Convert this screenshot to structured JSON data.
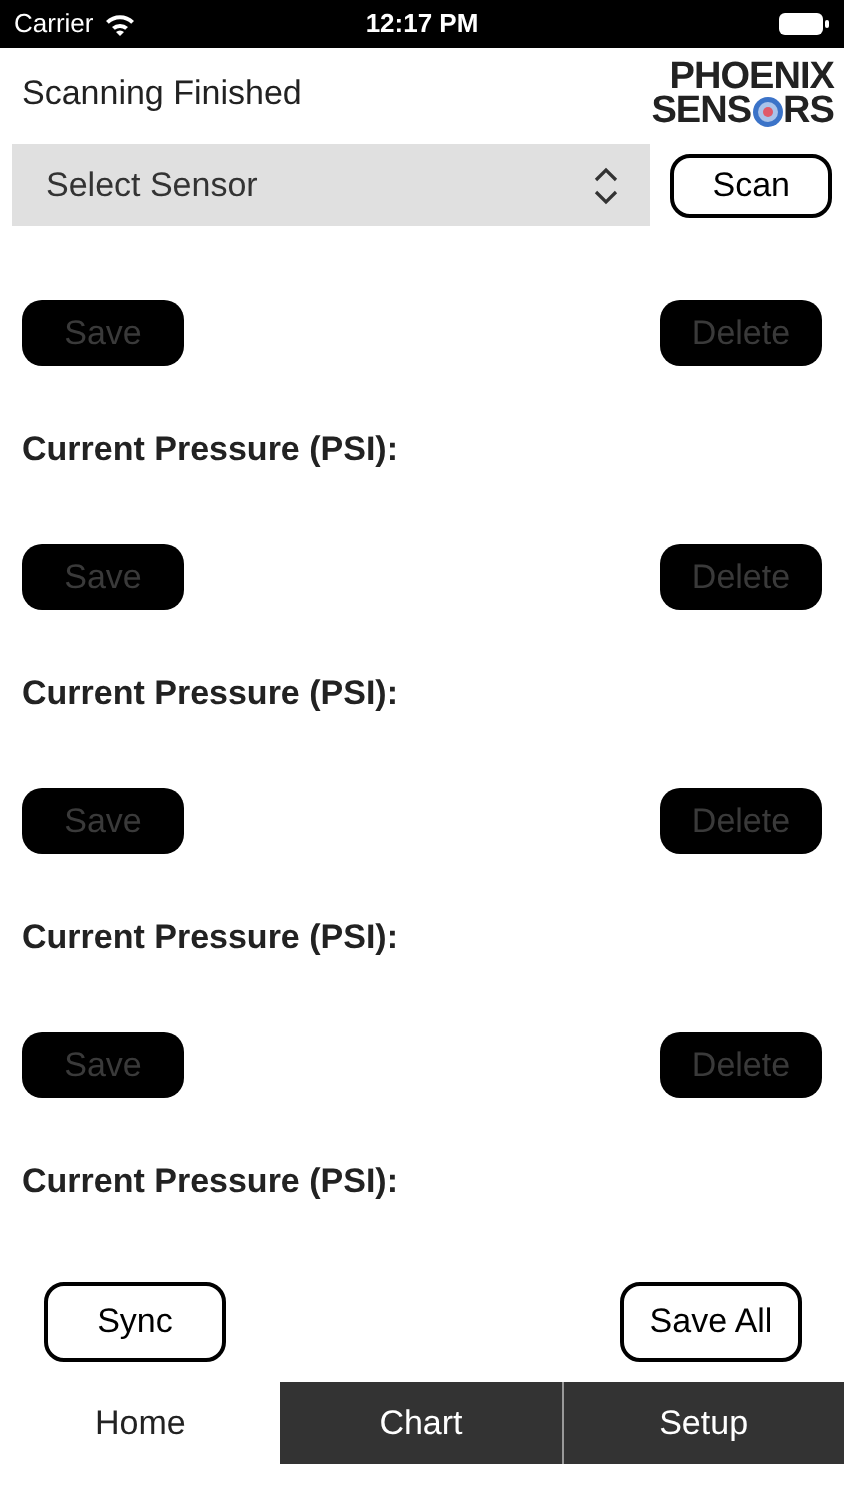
{
  "status_bar": {
    "carrier": "Carrier",
    "time": "12:17 PM"
  },
  "header": {
    "status": "Scanning Finished",
    "logo": {
      "line1": "PHOENIX",
      "line2_start": "SENS",
      "line2_end": "RS"
    }
  },
  "sensor_select": {
    "value": "Select Sensor"
  },
  "scan_button": "Scan",
  "sensors": [
    {
      "save": {
        "label": "Save",
        "disabled": true
      },
      "delete": {
        "label": "Delete",
        "disabled": true
      },
      "pressure_label": "Current Pressure (PSI):"
    },
    {
      "save": {
        "label": "Save",
        "disabled": true
      },
      "delete": {
        "label": "Delete",
        "disabled": true
      },
      "pressure_label": "Current Pressure (PSI):"
    },
    {
      "save": {
        "label": "Save",
        "disabled": true
      },
      "delete": {
        "label": "Delete",
        "disabled": true
      },
      "pressure_label": "Current Pressure (PSI):"
    },
    {
      "save": {
        "label": "Save",
        "disabled": true
      },
      "delete": {
        "label": "Delete",
        "disabled": true
      },
      "pressure_label": "Current Pressure (PSI):"
    }
  ],
  "sync_button": "Sync",
  "save_all_button": "Save All",
  "tabs": [
    {
      "label": "Home",
      "selected": true
    },
    {
      "label": "Chart",
      "selected": false
    },
    {
      "label": "Setup",
      "selected": false
    }
  ]
}
